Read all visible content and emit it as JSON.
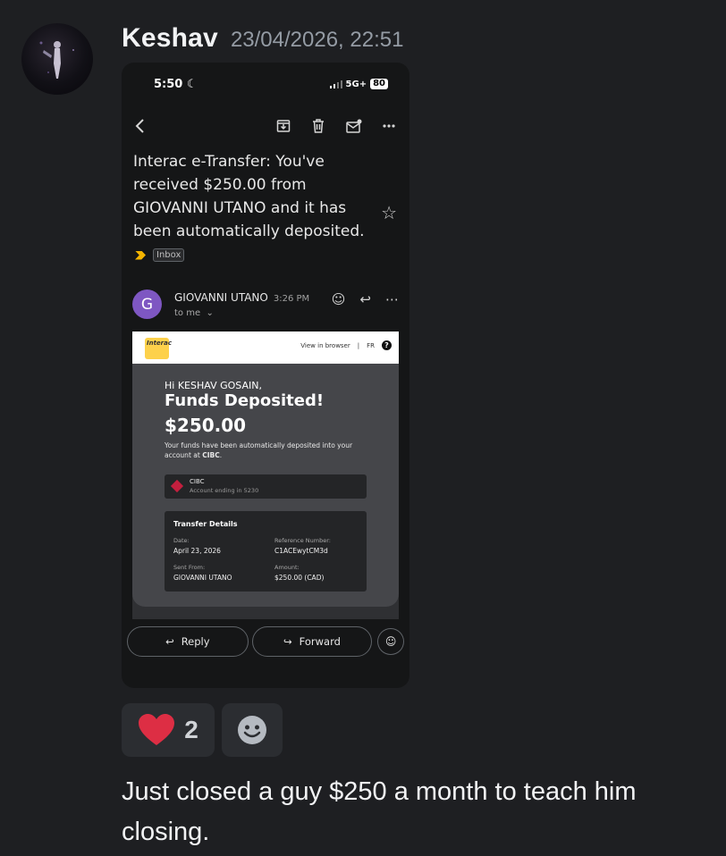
{
  "message": {
    "author": "Keshav",
    "timestamp": "23/04/2026, 22:51",
    "text": "Just closed a guy $250 a month to teach him closing.",
    "reactions": [
      {
        "emoji": "heart",
        "count": "2"
      },
      {
        "emoji": "add-reaction",
        "count": ""
      }
    ]
  },
  "screenshot": {
    "status_bar": {
      "time": "5:50",
      "network": "5G+",
      "battery": "80"
    },
    "email": {
      "subject": "Interac e-Transfer: You've received $250.00 from GIOVANNI UTANO and it has been automatically deposited.",
      "label": "Inbox",
      "sender": "GIOVANNI UTANO",
      "avatar_letter": "G",
      "time": "3:26 PM",
      "to": "to me",
      "body": {
        "logo_text": "Interac",
        "view_in_browser": "View in browser",
        "separator": "|",
        "lang": "FR",
        "help": "?",
        "greeting": "Hi KESHAV GOSAIN,",
        "title": "Funds Deposited!",
        "amount": "$250.00",
        "note_pre": "Your funds have been automatically deposited into your account at ",
        "note_bank": "CIBC",
        "note_post": ".",
        "account_bank": "CIBC",
        "account_ending": "Account ending in 5230",
        "details_title": "Transfer Details",
        "date_label": "Date:",
        "date_value": "April 23, 2026",
        "ref_label": "Reference Number:",
        "ref_value": "C1ACEwytCM3d",
        "sent_label": "Sent From:",
        "sent_value": "GIOVANNI UTANO",
        "amount_label": "Amount:",
        "amount_value": "$250.00 (CAD)"
      },
      "actions": {
        "reply": "Reply",
        "forward": "Forward"
      }
    }
  },
  "colors": {
    "background": "#1e1f22",
    "sender_avatar": "#7e57c2",
    "interac_yellow": "#fdd14b",
    "heart": "#dd2e44"
  }
}
